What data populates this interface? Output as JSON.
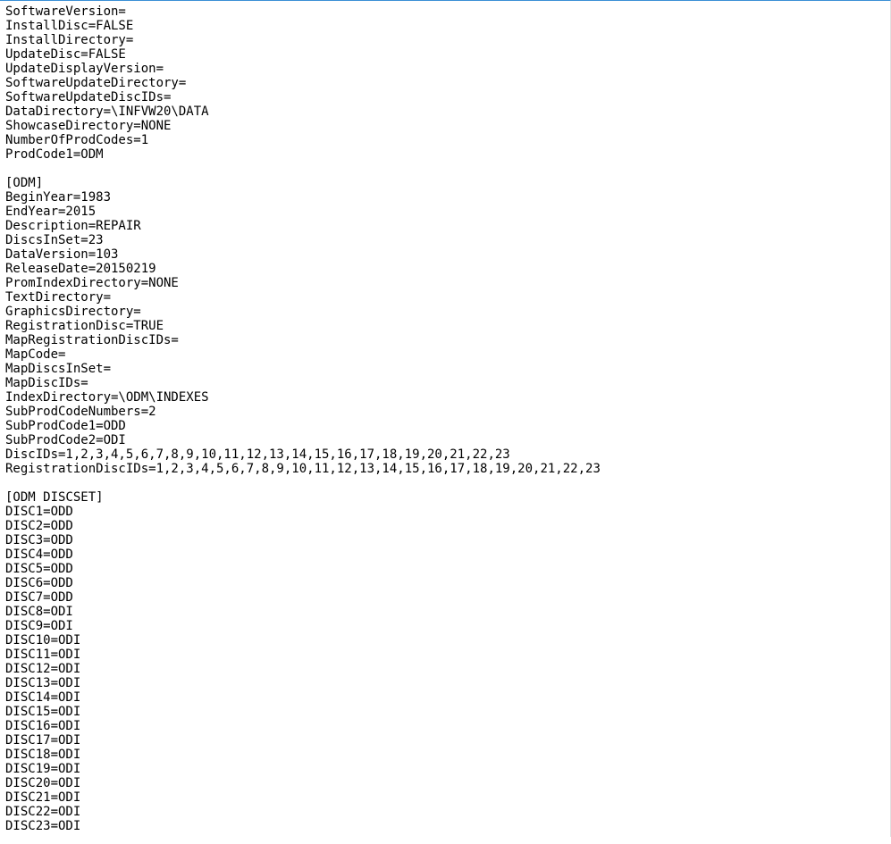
{
  "lines": [
    "SoftwareVersion=",
    "InstallDisc=FALSE",
    "InstallDirectory=",
    "UpdateDisc=FALSE",
    "UpdateDisplayVersion=",
    "SoftwareUpdateDirectory=",
    "SoftwareUpdateDiscIDs=",
    "DataDirectory=\\INFVW20\\DATA",
    "ShowcaseDirectory=NONE",
    "NumberOfProdCodes=1",
    "ProdCode1=ODM",
    "",
    "[ODM]",
    "BeginYear=1983",
    "EndYear=2015",
    "Description=REPAIR",
    "DiscsInSet=23",
    "DataVersion=103",
    "ReleaseDate=20150219",
    "PromIndexDirectory=NONE",
    "TextDirectory=",
    "GraphicsDirectory=",
    "RegistrationDisc=TRUE",
    "MapRegistrationDiscIDs=",
    "MapCode=",
    "MapDiscsInSet=",
    "MapDiscIDs=",
    "IndexDirectory=\\ODM\\INDEXES",
    "SubProdCodeNumbers=2",
    "SubProdCode1=ODD",
    "SubProdCode2=ODI",
    "DiscIDs=1,2,3,4,5,6,7,8,9,10,11,12,13,14,15,16,17,18,19,20,21,22,23",
    "RegistrationDiscIDs=1,2,3,4,5,6,7,8,9,10,11,12,13,14,15,16,17,18,19,20,21,22,23",
    "",
    "[ODM DISCSET]",
    "DISC1=ODD",
    "DISC2=ODD",
    "DISC3=ODD",
    "DISC4=ODD",
    "DISC5=ODD",
    "DISC6=ODD",
    "DISC7=ODD",
    "DISC8=ODI",
    "DISC9=ODI",
    "DISC10=ODI",
    "DISC11=ODI",
    "DISC12=ODI",
    "DISC13=ODI",
    "DISC14=ODI",
    "DISC15=ODI",
    "DISC16=ODI",
    "DISC17=ODI",
    "DISC18=ODI",
    "DISC19=ODI",
    "DISC20=ODI",
    "DISC21=ODI",
    "DISC22=ODI",
    "DISC23=ODI"
  ]
}
